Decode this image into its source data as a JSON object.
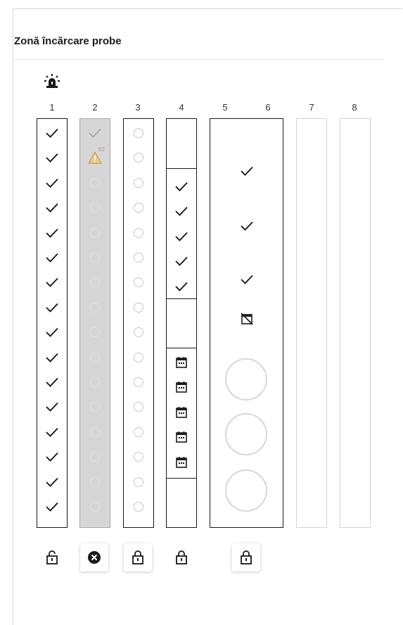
{
  "panel": {
    "title": "Zonă încărcare probe"
  },
  "header_icon": "siren-alarm-icon",
  "columns": [
    "1",
    "2",
    "3",
    "4",
    "5",
    "6",
    "7",
    "8"
  ],
  "rack2": {
    "warning_count": "02"
  },
  "lock_buttons": [
    {
      "icon": "lock-icon",
      "state": "unlocked"
    },
    {
      "icon": "close-circle-icon",
      "state": "error"
    },
    {
      "icon": "lock-icon",
      "state": "locked"
    },
    {
      "icon": "lock-icon",
      "state": "locked"
    },
    {
      "icon": "lock-icon",
      "state": "locked"
    }
  ],
  "colors": {
    "rack_border": "#1a1a1a",
    "disabled_fill": "#d6d6d6",
    "warning": "#e0b24a",
    "empty_border": "#d4d4d4"
  }
}
